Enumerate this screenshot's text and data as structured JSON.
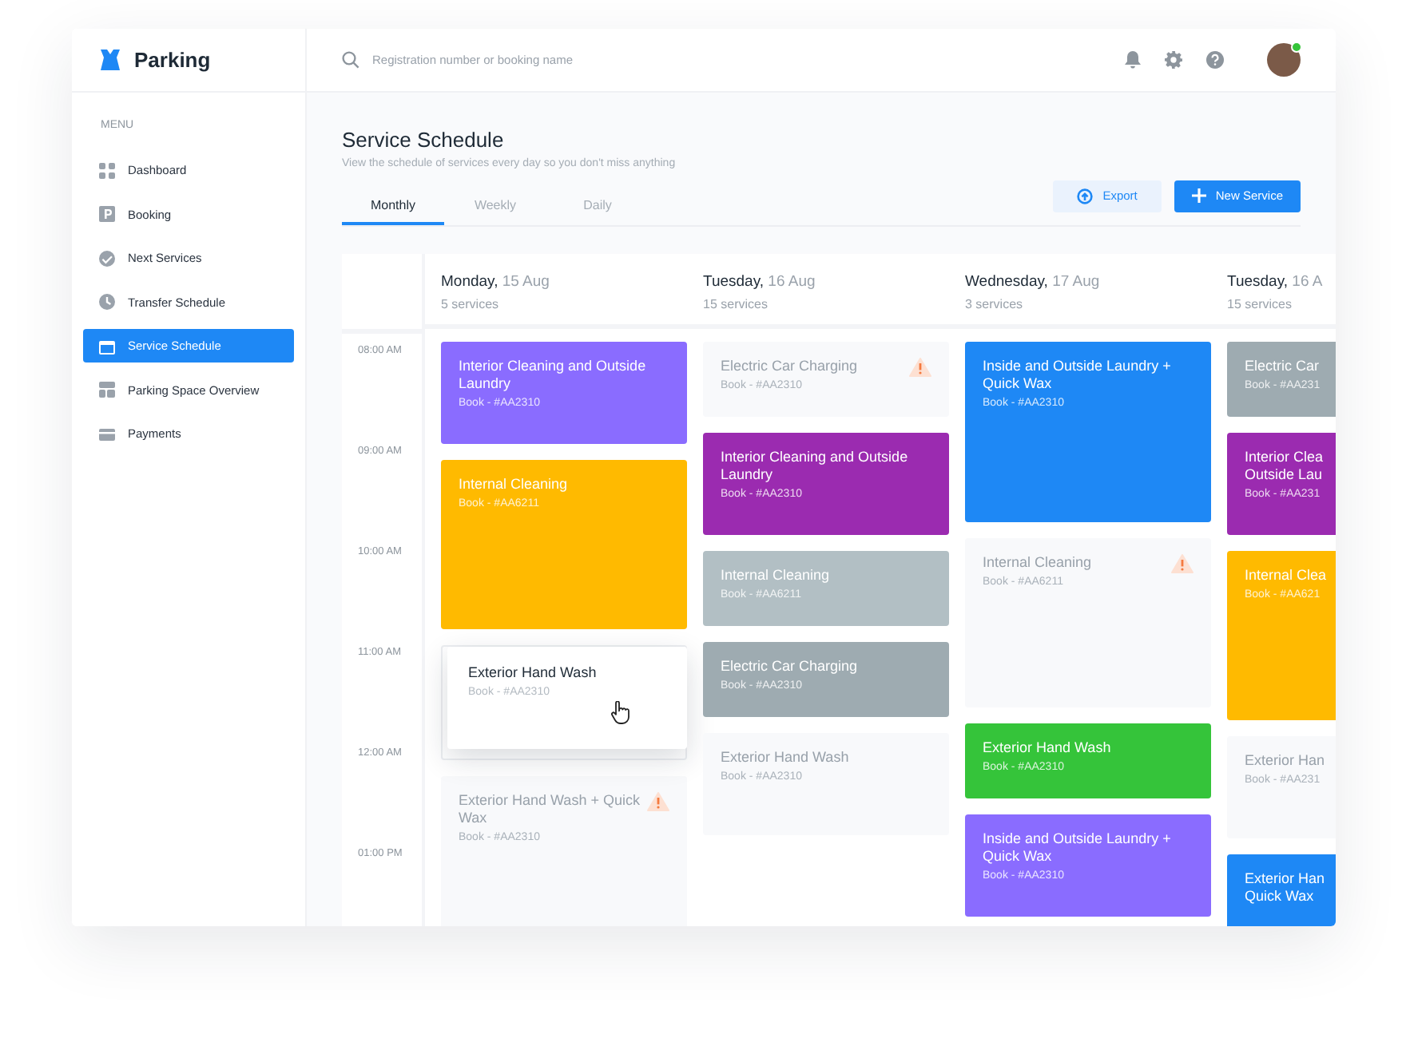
{
  "brand": {
    "name": "Parking"
  },
  "search": {
    "placeholder": "Registration number or booking name"
  },
  "user": {
    "online": true
  },
  "sidebar": {
    "heading": "MENU",
    "items": [
      {
        "label": "Dashboard",
        "selected": false
      },
      {
        "label": "Booking",
        "selected": false
      },
      {
        "label": "Next Services",
        "selected": false
      },
      {
        "label": "Transfer Schedule",
        "selected": false
      },
      {
        "label": "Service Schedule",
        "selected": true
      },
      {
        "label": "Parking Space Overview",
        "selected": false
      },
      {
        "label": "Payments",
        "selected": false
      }
    ]
  },
  "page": {
    "title": "Service Schedule",
    "subtitle": "View the schedule of services every day so you don't miss anything"
  },
  "tabs": [
    {
      "label": "Monthly",
      "selected": true
    },
    {
      "label": "Weekly",
      "selected": false
    },
    {
      "label": "Daily",
      "selected": false
    }
  ],
  "actions": [
    {
      "label": "Export",
      "kind": "secondary"
    },
    {
      "label": "New Service",
      "kind": "primary"
    }
  ],
  "schedule": {
    "times": [
      "08:00 AM",
      "09:00 AM",
      "10:00 AM",
      "11:00 AM",
      "12:00 AM",
      "01:00 PM"
    ],
    "days": [
      {
        "day": "Monday,",
        "date": "15 Aug",
        "count": "5 services",
        "cards": [
          {
            "kind": "medium",
            "color": "#8a6cff",
            "title": "Interior Cleaning and Outside Laundry",
            "book": "Book - #AA2310",
            "warning": false
          },
          {
            "kind": "tall",
            "color": "#ffba00",
            "title": "Internal Cleaning",
            "book": "Book - #AA6211",
            "warning": false
          },
          {
            "kind": "empty",
            "dragging": {
              "title": "Exterior Hand Wash",
              "book": "Book - #AA2310"
            }
          },
          {
            "kind": "tall",
            "title": "Exterior Hand Wash + Quick Wax",
            "book": "Book - #AA2310",
            "warning": true
          }
        ]
      },
      {
        "day": "Tuesday,",
        "date": "16 Aug",
        "count": "15 services",
        "cards": [
          {
            "kind": "short",
            "title": "Electric Car Charging",
            "book": "Book - #AA2310",
            "warning": true
          },
          {
            "kind": "medium",
            "color": "#9b2bb0",
            "title": "Interior Cleaning and Outside Laundry",
            "book": "Book - #AA2310",
            "warning": false
          },
          {
            "kind": "short",
            "color": "#b2bfc4",
            "title": "Internal Cleaning",
            "book": "Book - #AA6211",
            "warning": false
          },
          {
            "kind": "short",
            "color": "#9eabb1",
            "title": "Electric Car Charging",
            "book": "Book - #AA2310",
            "warning": false
          },
          {
            "kind": "medium",
            "title": "Exterior Hand Wash",
            "book": "Book - #AA2310",
            "warning": false
          }
        ]
      },
      {
        "day": "Wednesday,",
        "date": "17 Aug",
        "count": "3 services",
        "cards": [
          {
            "kind": "xtall",
            "color": "#1e88f5",
            "title": "Inside and Outside Laundry + Quick Wax",
            "book": "Book - #AA2310",
            "warning": false
          },
          {
            "kind": "tall",
            "title": "Internal Cleaning",
            "book": "Book - #AA6211",
            "warning": true
          },
          {
            "kind": "short",
            "color": "#35c43a",
            "title": "Exterior Hand Wash",
            "book": "Book - #AA2310",
            "warning": false
          },
          {
            "kind": "medium",
            "color": "#8a6cff",
            "title": "Inside and Outside Laundry + Quick Wax",
            "book": "Book - #AA2310",
            "warning": false
          }
        ]
      },
      {
        "day": "Tuesday,",
        "date": "16 A",
        "count": "15 services",
        "cards": [
          {
            "kind": "short",
            "color": "#9eabb1",
            "title": "Electric Car",
            "book": "Book - #AA231"
          },
          {
            "kind": "medium",
            "color": "#9b2bb0",
            "title": "Interior Clea\nOutside Lau",
            "book": "Book - #AA231"
          },
          {
            "kind": "tall",
            "color": "#ffba00",
            "title": "Internal Clea",
            "book": "Book - #AA621"
          },
          {
            "kind": "medium",
            "title": "Exterior Han",
            "book": "Book - #AA231"
          },
          {
            "kind": "medium",
            "color": "#1e88f5",
            "title": "Exterior Han\nQuick Wax"
          }
        ]
      }
    ]
  }
}
